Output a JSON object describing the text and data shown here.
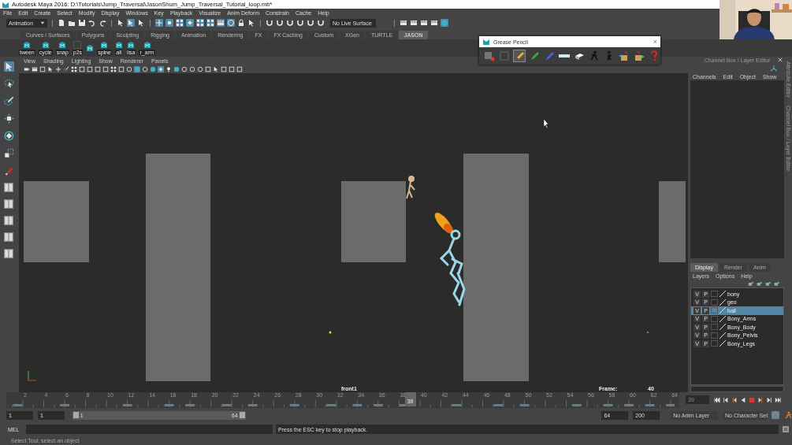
{
  "window": {
    "title": "Autodesk Maya 2016: D:\\Tutorials\\Jump_Traversal\\JasonShum_Jump_Traversal_Tutorial_loop.mb*"
  },
  "menu": [
    "File",
    "Edit",
    "Create",
    "Select",
    "Modify",
    "Display",
    "Windows",
    "Key",
    "Playback",
    "Visualize",
    "Anim Deform",
    "Constrain",
    "Cache",
    "Help"
  ],
  "status_line": {
    "mode": "Animation",
    "live_surface": "No Live Surface",
    "tools": [
      {
        "on": false
      },
      {
        "on": false
      },
      {
        "on": false
      },
      {
        "on": false
      },
      {
        "on": false
      },
      {
        "on": false
      },
      {
        "on": true
      },
      {
        "on": false
      },
      {
        "on": true
      },
      {
        "on": true
      },
      {
        "on": true
      },
      {
        "on": true
      },
      {
        "on": true
      },
      {
        "on": true
      },
      {
        "on": true
      },
      {
        "on": true
      },
      {
        "on": false
      },
      {
        "on": false
      },
      {
        "on": false
      },
      {
        "on": false
      },
      {
        "on": false
      },
      {
        "on": false
      },
      {
        "on": false
      },
      {
        "on": false
      }
    ],
    "tools_right": [
      {
        "on": false
      },
      {
        "on": false
      },
      {
        "on": false
      },
      {
        "on": false
      },
      {
        "on": true
      }
    ]
  },
  "shelf": {
    "tabs": [
      {
        "label": "Curves / Surfaces",
        "selected": false
      },
      {
        "label": "Polygons",
        "selected": false
      },
      {
        "label": "Sculpting",
        "selected": false
      },
      {
        "label": "Rigging",
        "selected": false
      },
      {
        "label": "Animation",
        "selected": false
      },
      {
        "label": "Rendering",
        "selected": false
      },
      {
        "label": "FX",
        "selected": false
      },
      {
        "label": "FX Caching",
        "selected": false
      },
      {
        "label": "Custom",
        "selected": false
      },
      {
        "label": "XGen",
        "selected": false
      },
      {
        "label": "TURTLE",
        "selected": false
      },
      {
        "label": "JASON",
        "selected": true
      }
    ],
    "items": [
      {
        "kind": "script",
        "label": "tween"
      },
      {
        "kind": "script",
        "label": "cycle"
      },
      {
        "kind": "script",
        "label": "snap"
      },
      {
        "kind": "empty",
        "label": "p2s"
      },
      {
        "kind": "script"
      },
      {
        "kind": "script",
        "label": "spine"
      },
      {
        "kind": "script",
        "label": "all"
      },
      {
        "kind": "script",
        "label": "lisa"
      },
      {
        "kind": "script",
        "label": "r_arm"
      }
    ]
  },
  "toolbox": [
    {
      "on": true
    },
    {
      "on": false
    },
    {
      "on": false
    },
    {
      "on": false
    },
    {
      "on": false
    },
    {
      "on": false
    },
    {
      "on": false
    }
  ],
  "viewport": {
    "menu": [
      "View",
      "Shading",
      "Lighting",
      "Show",
      "Renderer",
      "Panels"
    ],
    "tools": [
      {
        "on": false
      },
      {
        "on": false
      },
      {
        "on": false
      },
      {
        "on": false
      },
      {
        "on": false
      },
      {
        "on": false
      },
      {
        "on": false
      },
      {
        "on": false
      },
      {
        "on": false
      },
      {
        "on": false
      },
      {
        "on": false
      },
      {
        "on": false
      },
      {
        "on": false
      },
      {
        "on": false
      },
      {
        "on": true
      },
      {
        "on": false
      },
      {
        "on": false
      },
      {
        "on": true
      },
      {
        "on": false
      },
      {
        "on": false
      },
      {
        "on": false
      },
      {
        "on": false
      },
      {
        "on": false
      },
      {
        "on": false
      },
      {
        "on": false
      },
      {
        "on": false
      },
      {
        "on": false
      },
      {
        "on": false
      }
    ],
    "camera": "front1",
    "frame_label": "Frame:",
    "frame": "40"
  },
  "grease_pencil": {
    "title": "Grease Pencil",
    "close": "×",
    "tools": [
      {
        "on": false
      },
      {
        "on": false
      },
      {
        "on": true
      },
      {
        "on": false
      },
      {
        "on": false
      },
      {
        "on": false
      },
      {
        "on": false
      },
      {
        "on": false
      },
      {
        "on": false
      },
      {
        "on": false
      },
      {
        "on": false
      },
      {
        "on": false
      }
    ]
  },
  "channel_box": {
    "title": "Channel Box / Layer Editor",
    "menu": [
      "Channels",
      "Edit",
      "Object",
      "Show"
    ]
  },
  "layer_editor": {
    "tabs": [
      {
        "label": "Display",
        "selected": true
      },
      {
        "label": "Render",
        "selected": false
      },
      {
        "label": "Anim",
        "selected": false
      }
    ],
    "menu": [
      "Layers",
      "Options",
      "Help"
    ],
    "layers": [
      {
        "visible": "V",
        "playback": "P",
        "name": "bony",
        "selected": false
      },
      {
        "visible": "V",
        "playback": "P",
        "name": "geo",
        "selected": false
      },
      {
        "visible": "V",
        "playback": "P",
        "name": "ball",
        "selected": true
      },
      {
        "visible": "V",
        "playback": "P",
        "name": "Bony_Arms",
        "selected": false
      },
      {
        "visible": "V",
        "playback": "P",
        "name": "Bony_Body",
        "selected": false
      },
      {
        "visible": "V",
        "playback": "P",
        "name": "Bony_Pelvis",
        "selected": false
      },
      {
        "visible": "V",
        "playback": "P",
        "name": "Bony_Legs",
        "selected": false
      }
    ]
  },
  "side_tabs": [
    "Attribute Editor",
    "Channel Box / Layer Editor"
  ],
  "timeline": {
    "ticks": [
      "2",
      "4",
      "6",
      "8",
      "10",
      "12",
      "14",
      "16",
      "18",
      "20",
      "22",
      "24",
      "26",
      "28",
      "30",
      "32",
      "34",
      "36",
      "38",
      "40",
      "42",
      "44",
      "46",
      "48",
      "50",
      "52",
      "54",
      "56",
      "58",
      "60",
      "62",
      "64"
    ],
    "current": "39",
    "current_field": "39",
    "playing": true
  },
  "range": {
    "start": "1",
    "playback_start": "1",
    "slider_start": "1",
    "slider_end": "64",
    "playback_end": "64",
    "end": "200",
    "anim_layer": "No Anim Layer",
    "character_set": "No Character Set"
  },
  "command_line": {
    "label": "MEL",
    "result": "Press the ESC key to stop playback."
  },
  "help_line": "Select Tool: select an object"
}
